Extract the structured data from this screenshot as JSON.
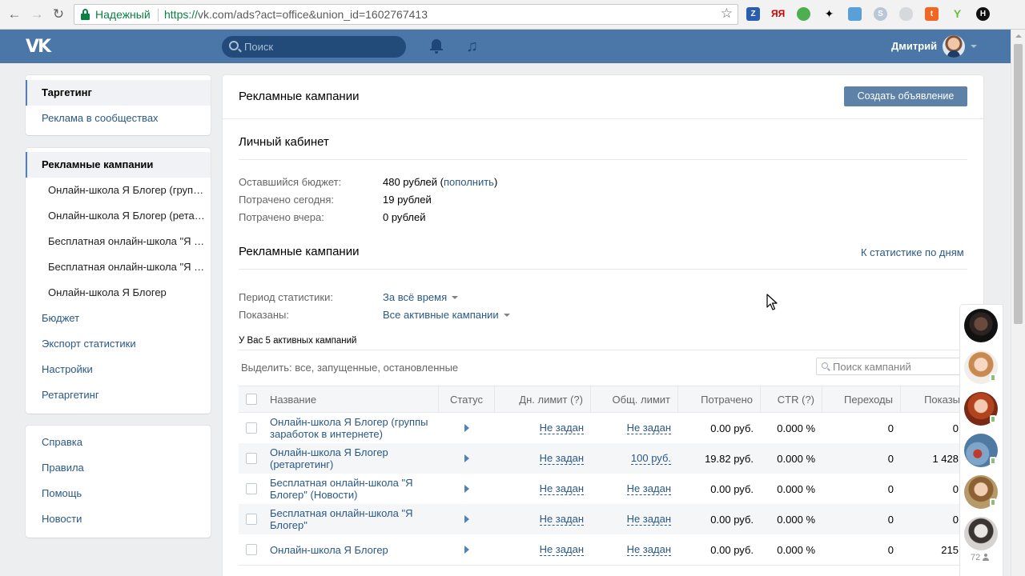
{
  "browser": {
    "secure_label": "Надежный",
    "url_scheme": "https://",
    "url_rest": "vk.com/ads?act=office&union_id=1602767413"
  },
  "header": {
    "logo": "VK",
    "search_placeholder": "Поиск",
    "user_name": "Дмитрий"
  },
  "sidebar": {
    "top": [
      {
        "label": "Таргетинг",
        "active": true
      },
      {
        "label": "Реклама в сообществах",
        "active": false
      }
    ],
    "campaigns_header": "Рекламные кампании",
    "campaigns": [
      "Онлайн-школа Я Блогер (группы заработок в интернете)",
      "Онлайн-школа Я Блогер (ретаргетинг)",
      "Бесплатная онлайн-школа \"Я Блогер\" (Новости)",
      "Бесплатная онлайн-школа \"Я Блогер\"",
      "Онлайн-школа Я Блогер"
    ],
    "more": [
      "Бюджет",
      "Экспорт статистики",
      "Настройки",
      "Ретаргетинг"
    ],
    "help": [
      "Справка",
      "Правила",
      "Помощь",
      "Новости"
    ]
  },
  "main": {
    "title": "Рекламные кампании",
    "create_button": "Создать объявление",
    "cabinet_title": "Личный кабинет",
    "budget": {
      "remaining_label": "Оставшийся бюджет:",
      "remaining_value": "480 рублей",
      "open_paren": " (",
      "topup_link": "пополнить",
      "close_paren": ")",
      "today_label": "Потрачено сегодня:",
      "today_value": "19 рублей",
      "yesterday_label": "Потрачено вчера:",
      "yesterday_value": "0 рублей"
    },
    "campaigns_title": "Рекламные кампании",
    "stats_by_days_link": "К статистике по дням",
    "period_label": "Период статистики:",
    "period_value": "За всё время",
    "shown_label": "Показаны:",
    "shown_value": "Все активные кампании",
    "active_count_note": "У Вас 5 активных кампаний",
    "select_prefix": "Выделить: ",
    "select_all": "все",
    "comma1": ", ",
    "select_running": "запущенные",
    "comma2": ", ",
    "select_stopped": "остановленные",
    "campaign_search_placeholder": "Поиск кампаний"
  },
  "table": {
    "columns": [
      "Название",
      "Статус",
      "Дн. лимит (?)",
      "Общ. лимит",
      "Потрачено",
      "CTR (?)",
      "Переходы",
      "Показы"
    ],
    "rows": [
      {
        "name": "Онлайн-школа Я Блогер (группы заработок в интернете)",
        "status": "running",
        "day_limit": "Не задан",
        "total_limit": "Не задан",
        "spent": "0.00 руб.",
        "ctr": "0.000 %",
        "clicks": "0",
        "impressions": "0"
      },
      {
        "name": "Онлайн-школа Я Блогер (ретаргетинг)",
        "status": "running",
        "day_limit": "Не задан",
        "total_limit": "100 руб.",
        "spent": "19.82 руб.",
        "ctr": "0.000 %",
        "clicks": "0",
        "impressions": "1 428"
      },
      {
        "name": "Бесплатная онлайн-школа \"Я Блогер\" (Новости)",
        "status": "running",
        "day_limit": "Не задан",
        "total_limit": "Не задан",
        "spent": "0.00 руб.",
        "ctr": "0.000 %",
        "clicks": "0",
        "impressions": "0"
      },
      {
        "name": "Бесплатная онлайн-школа \"Я Блогер\"",
        "status": "running",
        "day_limit": "Не задан",
        "total_limit": "Не задан",
        "spent": "0.00 руб.",
        "ctr": "0.000 %",
        "clicks": "0",
        "impressions": "0"
      },
      {
        "name": "Онлайн-школа Я Блогер",
        "status": "running",
        "day_limit": "Не задан",
        "total_limit": "Не задан",
        "spent": "0.00 руб.",
        "ctr": "0.000 %",
        "clicks": "0",
        "impressions": "215"
      }
    ]
  },
  "chat": {
    "online_count": "72"
  },
  "colors": {
    "vk_blue": "#4a76a8",
    "link": "#2a5885",
    "button": "#5e81a8",
    "secure_green": "#0b8043",
    "online_green": "#8ac176"
  }
}
